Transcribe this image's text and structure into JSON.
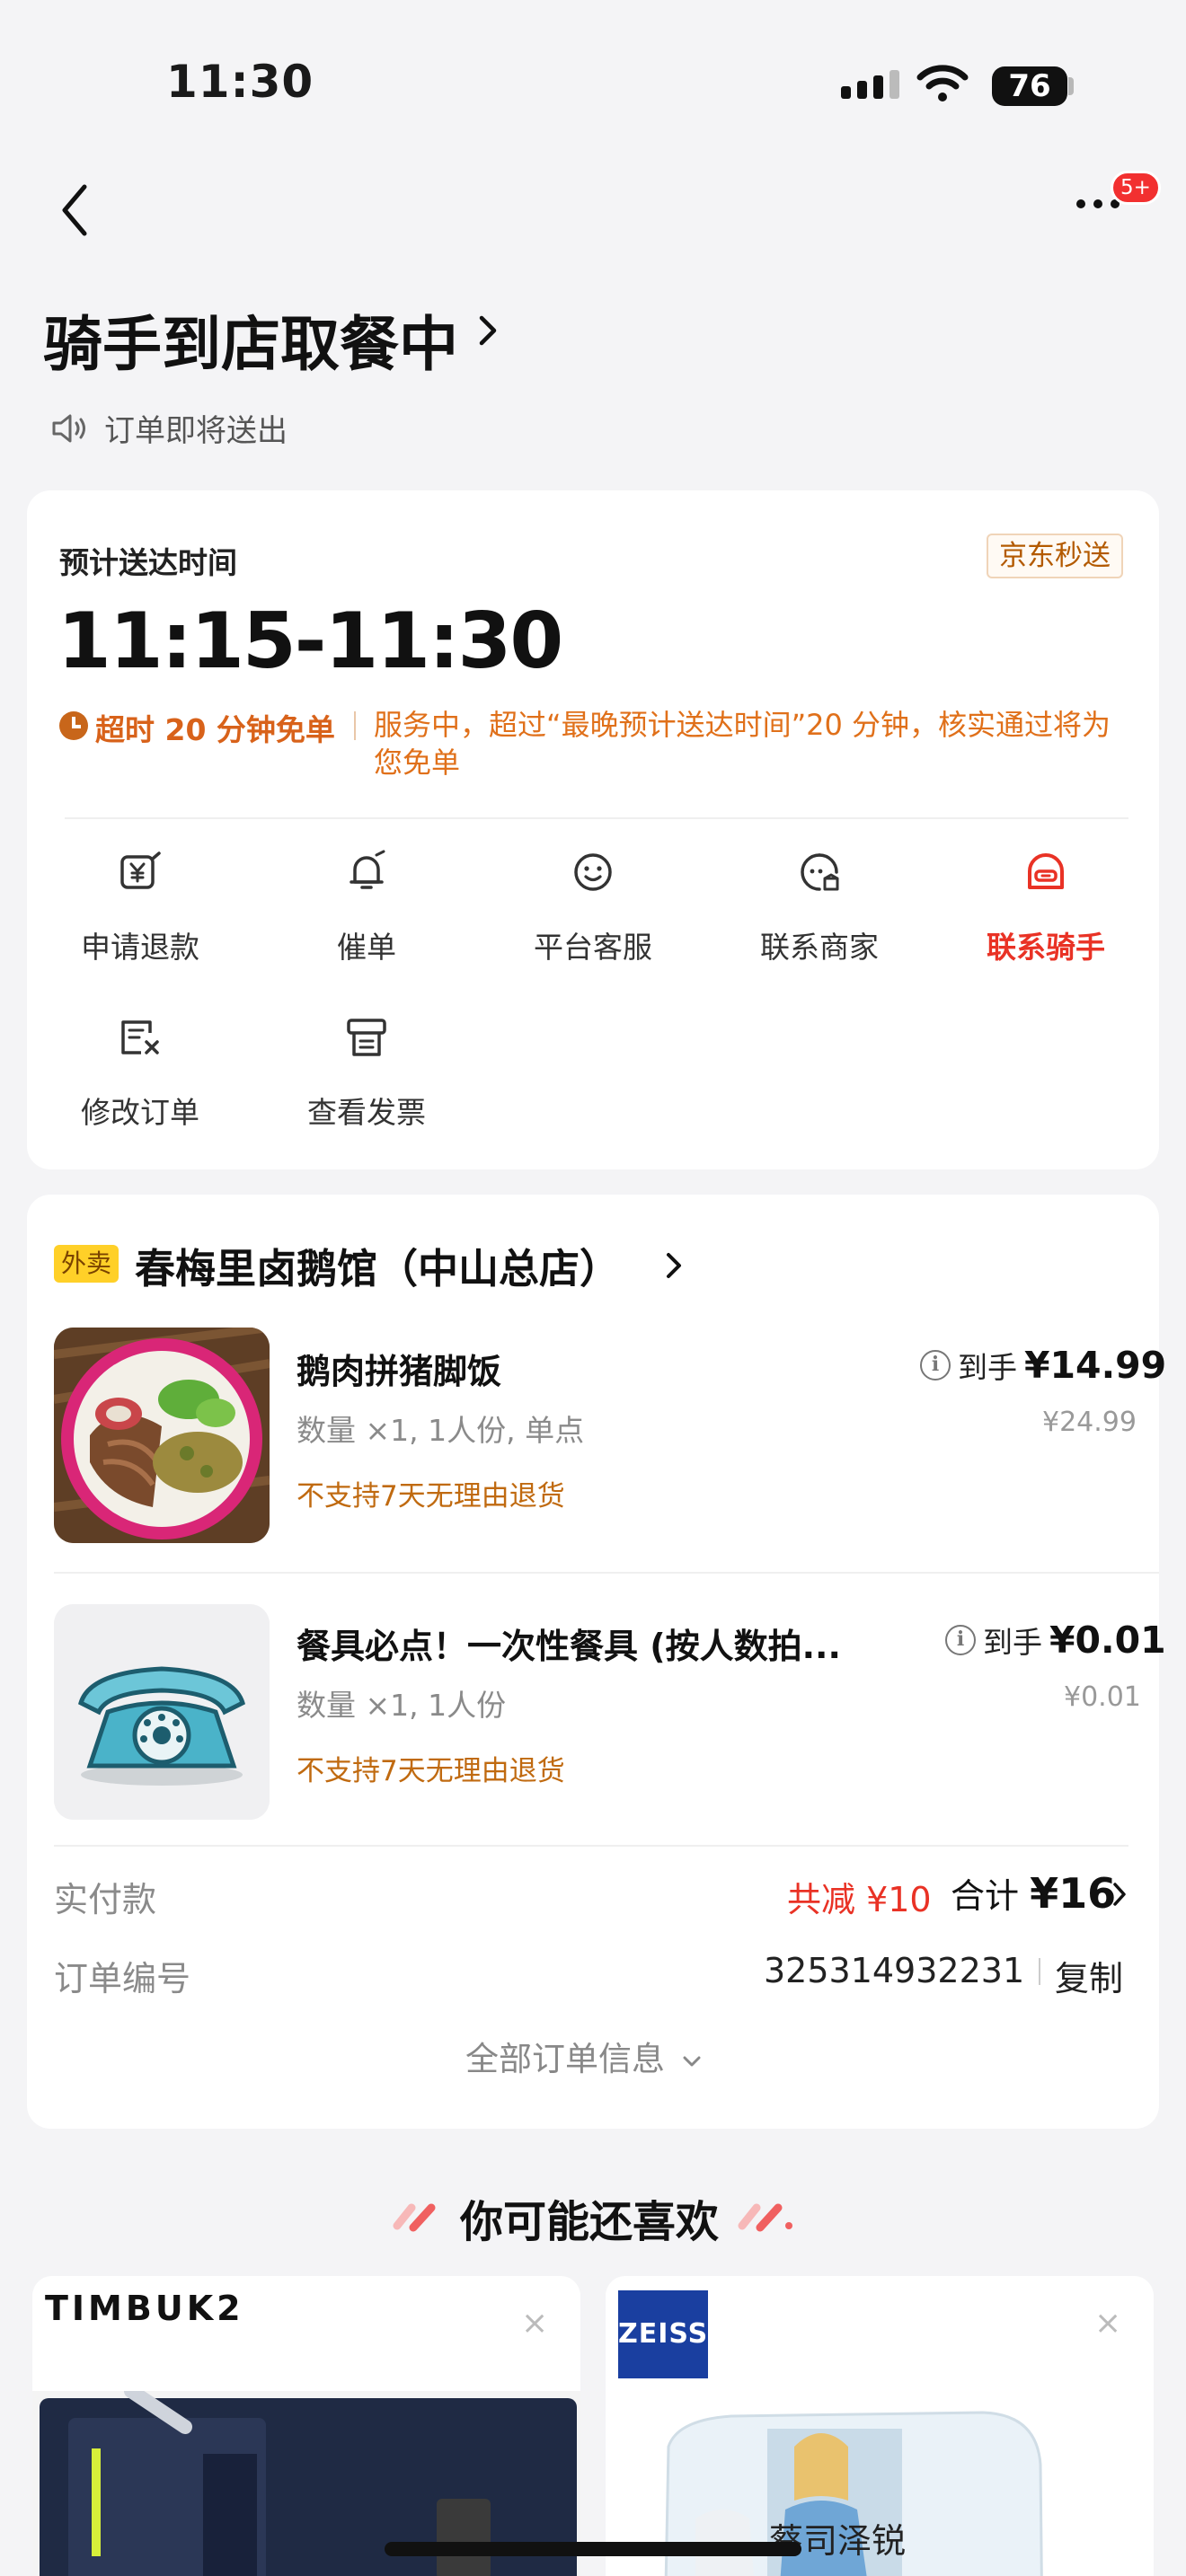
{
  "status_bar": {
    "time": "11:30",
    "battery": "76"
  },
  "nav": {
    "badge": "5+"
  },
  "order_status": {
    "title": "骑手到店取餐中",
    "notice": "订单即将送出"
  },
  "delivery": {
    "eta_label": "预计送达时间",
    "service_tag": "京东秒送",
    "eta_time": "11:15-11:30",
    "late_title": "超时 20 分钟免单",
    "late_desc": "服务中，超过“最晚预计送达时间”20 分钟，核实通过将为您免单"
  },
  "actions": [
    {
      "label": "申请退款",
      "icon": "refund-icon"
    },
    {
      "label": "催单",
      "icon": "bell-icon"
    },
    {
      "label": "平台客服",
      "icon": "service-face-icon"
    },
    {
      "label": "联系商家",
      "icon": "merchant-chat-icon"
    },
    {
      "label": "联系骑手",
      "icon": "rider-helmet-icon",
      "color": "#e93225"
    },
    {
      "label": "修改订单",
      "icon": "edit-order-icon"
    },
    {
      "label": "查看发票",
      "icon": "invoice-icon"
    }
  ],
  "shop": {
    "tag": "外卖",
    "name": "春梅里卤鹅馆（中山总店）"
  },
  "items": [
    {
      "name": "鹅肉拼猪脚饭",
      "spec": "数量 ×1, 1人份, 单点",
      "warning": "不支持7天无理由退货",
      "price_prefix": "到手",
      "price_now": "¥14.99",
      "price_orig": "¥24.99"
    },
    {
      "name": "餐具必点！一次性餐具 (按人数拍...",
      "spec": "数量 ×1, 1人份",
      "warning": "不支持7天无理由退货",
      "price_prefix": "到手",
      "price_now": "¥0.01",
      "price_orig": "¥0.01"
    }
  ],
  "summary": {
    "paid_label": "实付款",
    "discount": "共减 ¥10",
    "total_label": "合计 ",
    "total_value": "¥16",
    "order_no_label": "订单编号",
    "order_no": "325314932231",
    "copy": "复制",
    "all_info": "全部订单信息"
  },
  "recommend": {
    "title": "你可能还喜欢",
    "cards": [
      {
        "brand": "TIMBUK2",
        "close": "×"
      },
      {
        "brand": "ZEISS",
        "product": "蔡司泽锐",
        "close": "×"
      }
    ]
  },
  "colors": {
    "accent_red": "#e93225",
    "warning_orange": "#e0701a",
    "background": "#f4f4f6"
  }
}
